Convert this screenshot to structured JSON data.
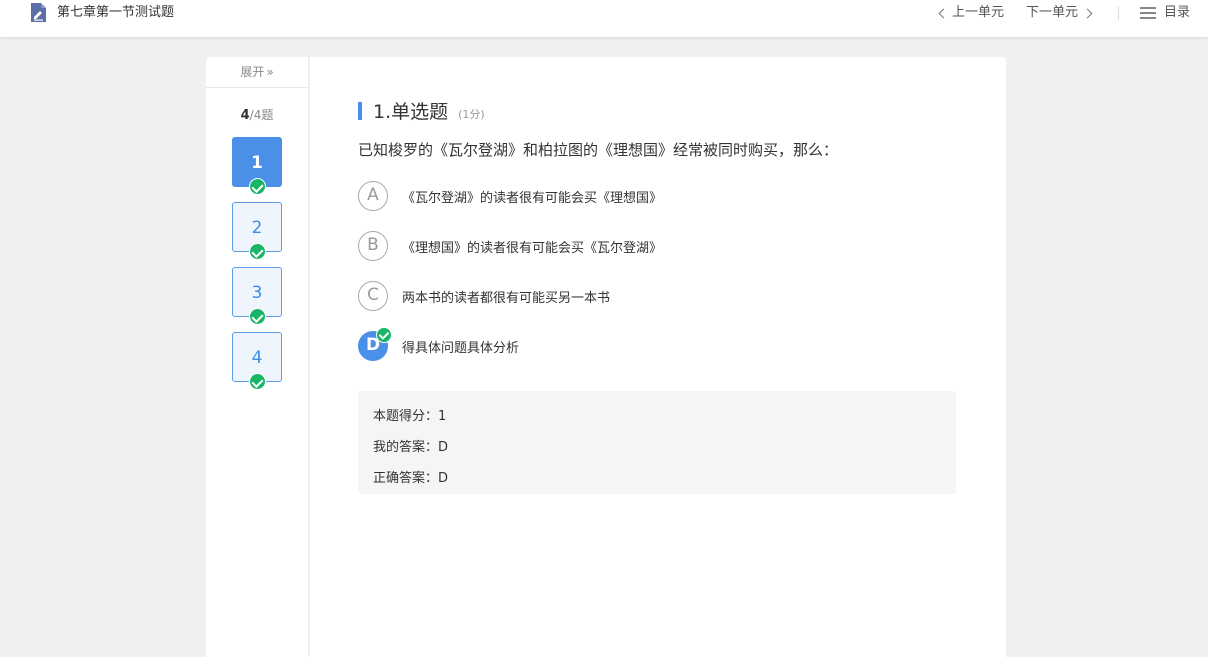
{
  "header": {
    "title": "第七章第一节测试题",
    "prev_label": "上一单元",
    "next_label": "下一单元",
    "menu_label": "目录"
  },
  "sidebar": {
    "expand_label": "展开",
    "current": "4",
    "total": "/4题",
    "questions": [
      {
        "num": "1",
        "active": true,
        "done": true
      },
      {
        "num": "2",
        "active": false,
        "done": true
      },
      {
        "num": "3",
        "active": false,
        "done": true
      },
      {
        "num": "4",
        "active": false,
        "done": true
      }
    ]
  },
  "question": {
    "type_label": "1.单选题",
    "score_label": "(1分)",
    "text": "已知梭罗的《瓦尔登湖》和柏拉图的《理想国》经常被同时购买，那么：",
    "options": [
      {
        "letter": "A",
        "text": "《瓦尔登湖》的读者很有可能会买《理想国》",
        "selected": false
      },
      {
        "letter": "B",
        "text": "《理想国》的读者很有可能会买《瓦尔登湖》",
        "selected": false
      },
      {
        "letter": "C",
        "text": "两本书的读者都很有可能买另一本书",
        "selected": false
      },
      {
        "letter": "D",
        "text": "得具体问题具体分析",
        "selected": true
      }
    ]
  },
  "result": {
    "score_line": "本题得分：1",
    "my_answer_line": "我的答案：D",
    "correct_answer_line": "正确答案：D"
  },
  "colors": {
    "accent": "#4a90e8",
    "success": "#19b566",
    "background": "#f0f0f0"
  }
}
